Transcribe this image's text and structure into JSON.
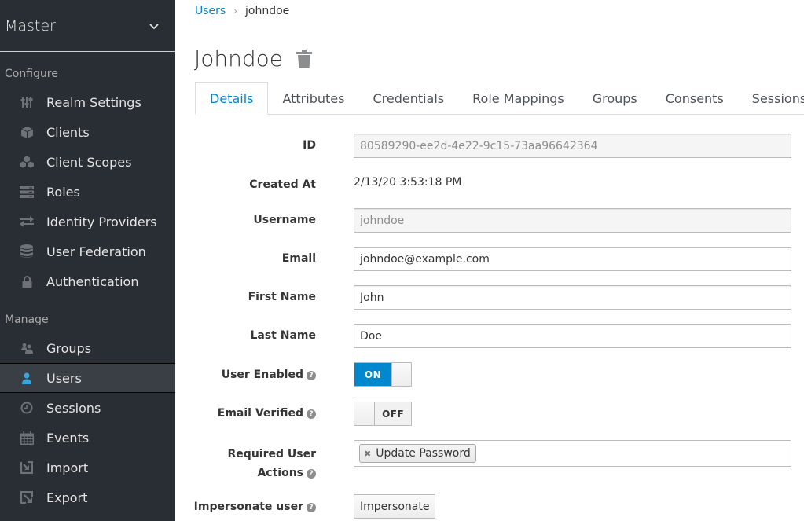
{
  "sidebar": {
    "realm": "Master",
    "configure_label": "Configure",
    "manage_label": "Manage",
    "configure_items": [
      {
        "label": "Realm Settings",
        "icon": "sliders-icon"
      },
      {
        "label": "Clients",
        "icon": "cube-icon"
      },
      {
        "label": "Client Scopes",
        "icon": "cubes-icon"
      },
      {
        "label": "Roles",
        "icon": "server-icon"
      },
      {
        "label": "Identity Providers",
        "icon": "exchange-icon"
      },
      {
        "label": "User Federation",
        "icon": "database-icon"
      },
      {
        "label": "Authentication",
        "icon": "lock-icon"
      }
    ],
    "manage_items": [
      {
        "label": "Groups",
        "icon": "users-icon"
      },
      {
        "label": "Users",
        "icon": "user-icon",
        "active": true
      },
      {
        "label": "Sessions",
        "icon": "clock-icon"
      },
      {
        "label": "Events",
        "icon": "calendar-icon"
      },
      {
        "label": "Import",
        "icon": "import-icon"
      },
      {
        "label": "Export",
        "icon": "export-icon"
      }
    ]
  },
  "breadcrumb": {
    "parent": "Users",
    "separator": "›",
    "current": "johndoe"
  },
  "page_title": "Johndoe",
  "tabs": [
    "Details",
    "Attributes",
    "Credentials",
    "Role Mappings",
    "Groups",
    "Consents",
    "Sessions"
  ],
  "active_tab": "Details",
  "form": {
    "id_label": "ID",
    "id_value": "80589290-ee2d-4e22-9c15-73aa96642364",
    "created_label": "Created At",
    "created_value": "2/13/20 3:53:18 PM",
    "username_label": "Username",
    "username_value": "johndoe",
    "email_label": "Email",
    "email_value": "johndoe@example.com",
    "first_name_label": "First Name",
    "first_name_value": "John",
    "last_name_label": "Last Name",
    "last_name_value": "Doe",
    "user_enabled_label": "User Enabled",
    "user_enabled_state": "ON",
    "email_verified_label": "Email Verified",
    "email_verified_state": "OFF",
    "required_actions_label_1": "Required User",
    "required_actions_label_2": "Actions",
    "required_actions": [
      "Update Password"
    ],
    "chip_remove": "✖",
    "impersonate_label": "Impersonate user",
    "impersonate_button": "Impersonate",
    "help_glyph": "?"
  },
  "colors": {
    "accent": "#0088ce",
    "sidebar_bg": "#292e34",
    "active_item_bg": "#393f44"
  }
}
